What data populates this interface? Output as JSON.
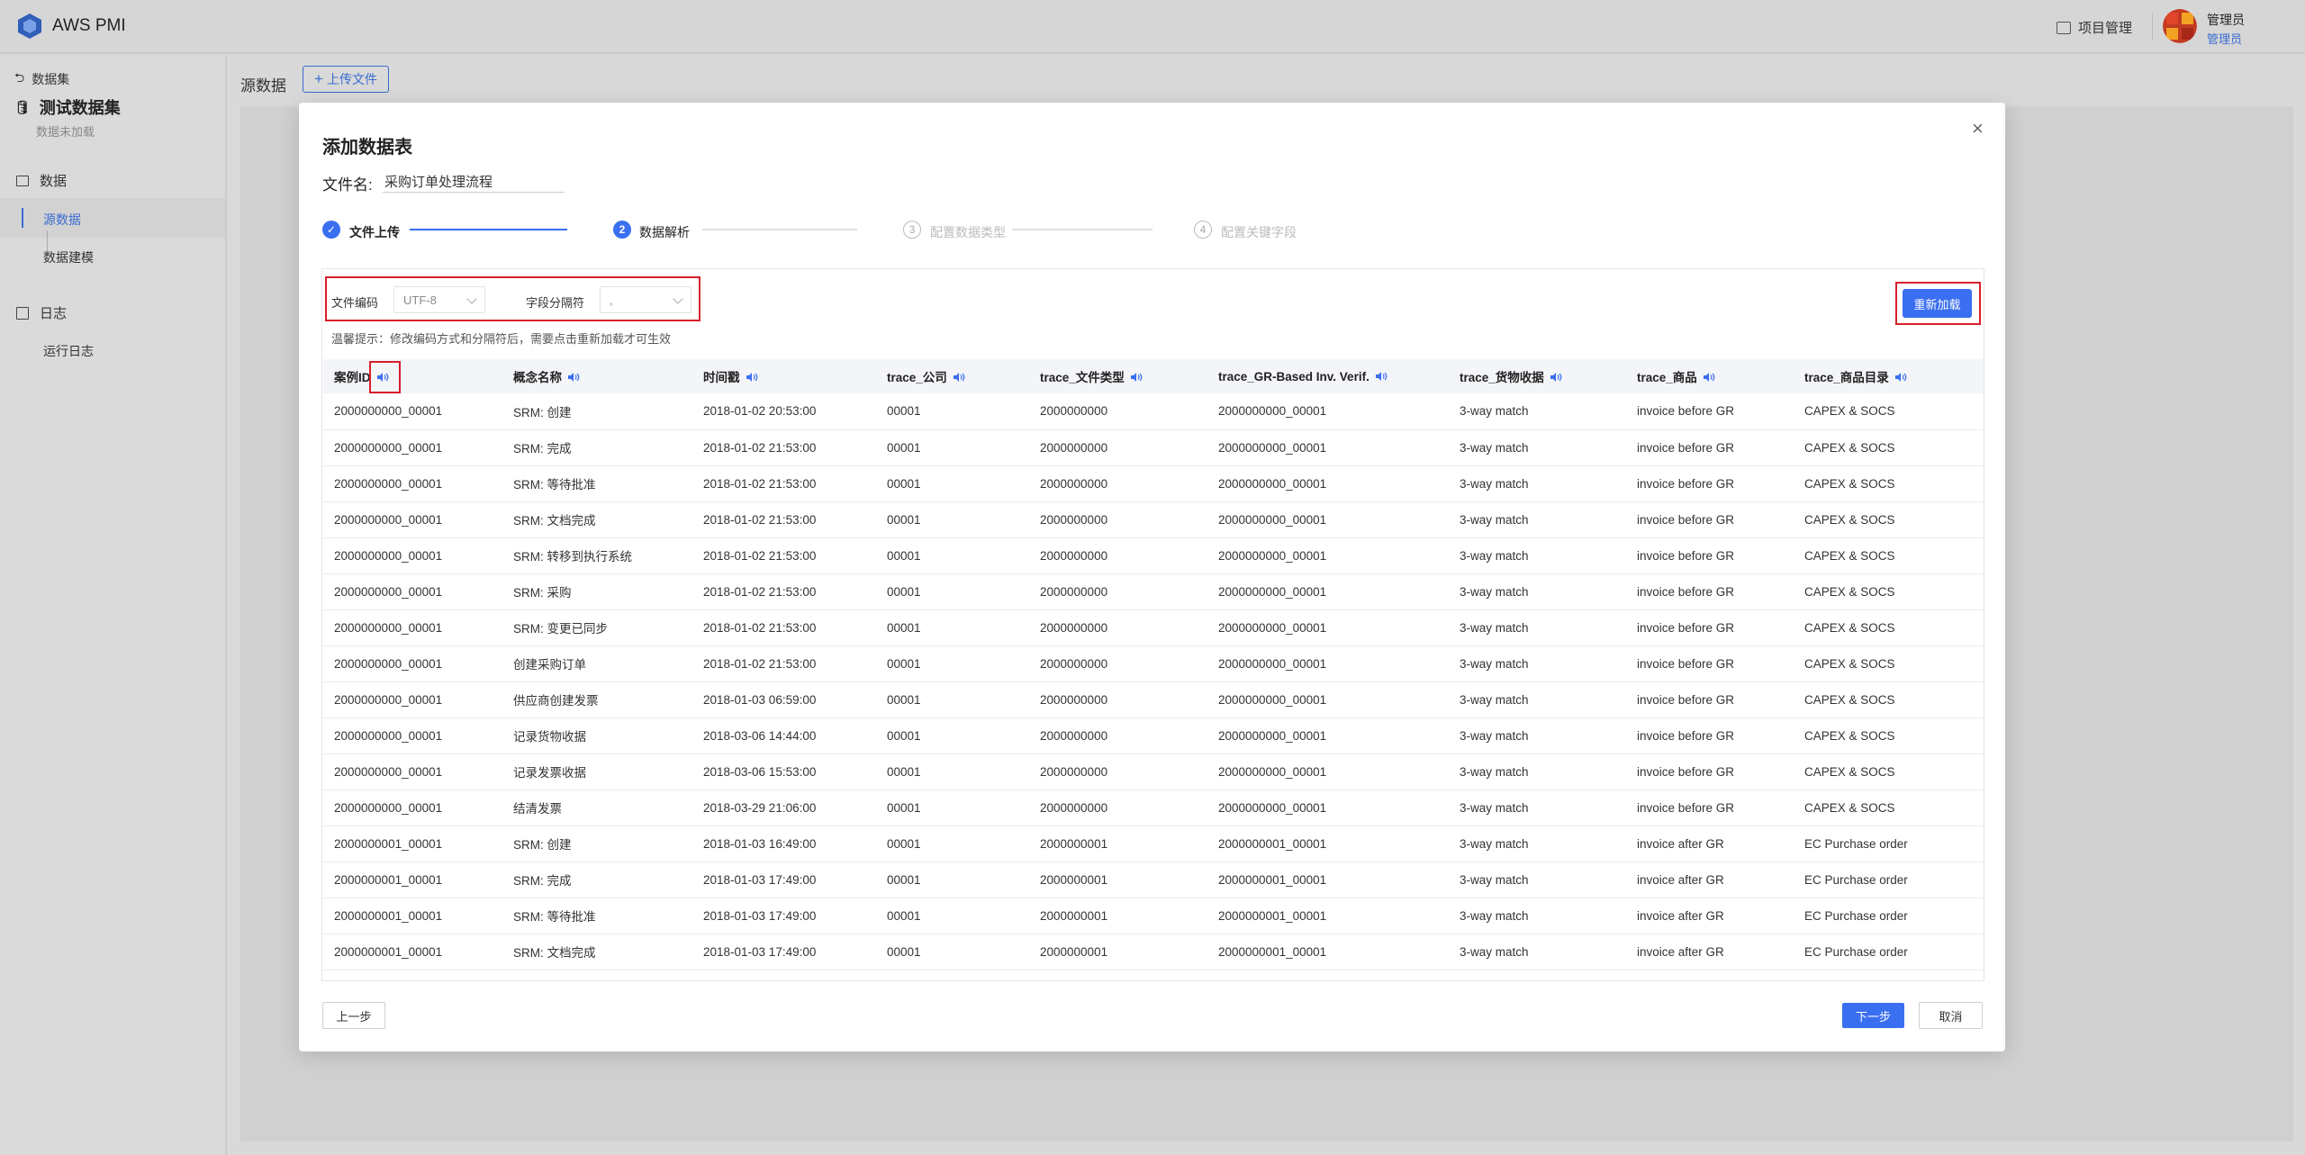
{
  "app": {
    "title": "AWS PMI",
    "project_mgmt": "项目管理",
    "user_name": "管理员",
    "user_role": "管理员"
  },
  "sidebar": {
    "back": "数据集",
    "dataset_name": "测试数据集",
    "dataset_status": "数据未加载",
    "groups": [
      {
        "label": "数据",
        "items": [
          "源数据",
          "数据建模"
        ]
      },
      {
        "label": "日志",
        "items": [
          "运行日志"
        ]
      }
    ]
  },
  "page": {
    "title": "源数据",
    "upload_label": "上传文件"
  },
  "modal": {
    "title": "添加数据表",
    "file_name_label": "文件名:",
    "file_name_value": "采购订单处理流程",
    "steps": [
      {
        "num": "1",
        "label": "文件上传",
        "state": "done"
      },
      {
        "num": "2",
        "label": "数据解析",
        "state": "active"
      },
      {
        "num": "3",
        "label": "配置数据类型",
        "state": "pending"
      },
      {
        "num": "4",
        "label": "配置关键字段",
        "state": "pending"
      }
    ],
    "encoding_label": "文件编码",
    "encoding_value": "UTF-8",
    "separator_label": "字段分隔符",
    "separator_value": ",",
    "hint": "温馨提示：修改编码方式和分隔符后，需要点击重新加载才可生效",
    "reload_label": "重新加载",
    "prev_label": "上一步",
    "next_label": "下一步",
    "cancel_label": "取消",
    "columns": [
      "案例ID",
      "概念名称",
      "时间戳",
      "trace_公司",
      "trace_文件类型",
      "trace_GR-Based Inv. Verif.",
      "trace_货物收据",
      "trace_商品",
      "trace_商品目录"
    ],
    "rows": [
      [
        "2000000000_00001",
        "SRM: 创建",
        "2018-01-02 20:53:00",
        "00001",
        "2000000000",
        "2000000000_00001",
        "3-way match",
        "invoice before GR",
        "CAPEX & SOCS"
      ],
      [
        "2000000000_00001",
        "SRM: 完成",
        "2018-01-02 21:53:00",
        "00001",
        "2000000000",
        "2000000000_00001",
        "3-way match",
        "invoice before GR",
        "CAPEX & SOCS"
      ],
      [
        "2000000000_00001",
        "SRM: 等待批准",
        "2018-01-02 21:53:00",
        "00001",
        "2000000000",
        "2000000000_00001",
        "3-way match",
        "invoice before GR",
        "CAPEX & SOCS"
      ],
      [
        "2000000000_00001",
        "SRM: 文档完成",
        "2018-01-02 21:53:00",
        "00001",
        "2000000000",
        "2000000000_00001",
        "3-way match",
        "invoice before GR",
        "CAPEX & SOCS"
      ],
      [
        "2000000000_00001",
        "SRM: 转移到执行系统",
        "2018-01-02 21:53:00",
        "00001",
        "2000000000",
        "2000000000_00001",
        "3-way match",
        "invoice before GR",
        "CAPEX & SOCS"
      ],
      [
        "2000000000_00001",
        "SRM: 采购",
        "2018-01-02 21:53:00",
        "00001",
        "2000000000",
        "2000000000_00001",
        "3-way match",
        "invoice before GR",
        "CAPEX & SOCS"
      ],
      [
        "2000000000_00001",
        "SRM: 变更已同步",
        "2018-01-02 21:53:00",
        "00001",
        "2000000000",
        "2000000000_00001",
        "3-way match",
        "invoice before GR",
        "CAPEX & SOCS"
      ],
      [
        "2000000000_00001",
        "创建采购订单",
        "2018-01-02 21:53:00",
        "00001",
        "2000000000",
        "2000000000_00001",
        "3-way match",
        "invoice before GR",
        "CAPEX & SOCS"
      ],
      [
        "2000000000_00001",
        "供应商创建发票",
        "2018-01-03 06:59:00",
        "00001",
        "2000000000",
        "2000000000_00001",
        "3-way match",
        "invoice before GR",
        "CAPEX & SOCS"
      ],
      [
        "2000000000_00001",
        "记录货物收据",
        "2018-03-06 14:44:00",
        "00001",
        "2000000000",
        "2000000000_00001",
        "3-way match",
        "invoice before GR",
        "CAPEX & SOCS"
      ],
      [
        "2000000000_00001",
        "记录发票收据",
        "2018-03-06 15:53:00",
        "00001",
        "2000000000",
        "2000000000_00001",
        "3-way match",
        "invoice before GR",
        "CAPEX & SOCS"
      ],
      [
        "2000000000_00001",
        "结清发票",
        "2018-03-29 21:06:00",
        "00001",
        "2000000000",
        "2000000000_00001",
        "3-way match",
        "invoice before GR",
        "CAPEX & SOCS"
      ],
      [
        "2000000001_00001",
        "SRM: 创建",
        "2018-01-03 16:49:00",
        "00001",
        "2000000001",
        "2000000001_00001",
        "3-way match",
        "invoice after GR",
        "EC Purchase order"
      ],
      [
        "2000000001_00001",
        "SRM: 完成",
        "2018-01-03 17:49:00",
        "00001",
        "2000000001",
        "2000000001_00001",
        "3-way match",
        "invoice after GR",
        "EC Purchase order"
      ],
      [
        "2000000001_00001",
        "SRM: 等待批准",
        "2018-01-03 17:49:00",
        "00001",
        "2000000001",
        "2000000001_00001",
        "3-way match",
        "invoice after GR",
        "EC Purchase order"
      ],
      [
        "2000000001_00001",
        "SRM: 文档完成",
        "2018-01-03 17:49:00",
        "00001",
        "2000000001",
        "2000000001_00001",
        "3-way match",
        "invoice after GR",
        "EC Purchase order"
      ]
    ]
  },
  "colors": {
    "accent": "#3a6ff1",
    "highlight": "#d81e2c",
    "text": "#333333"
  },
  "icons": {
    "speaker": "speaker-icon",
    "close": "close-icon",
    "check": "check-icon"
  }
}
